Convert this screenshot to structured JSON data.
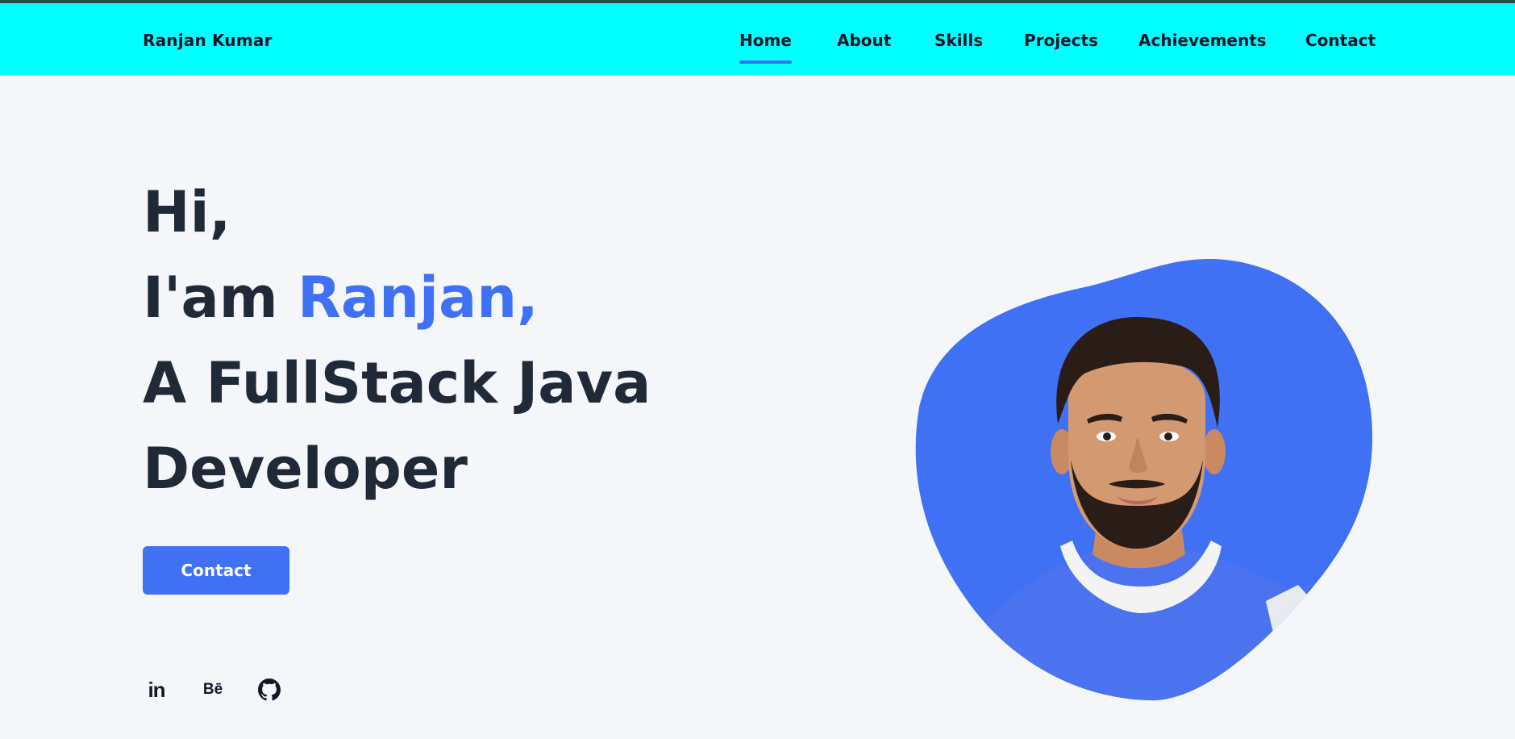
{
  "brand": "Ranjan Kumar",
  "nav": {
    "items": [
      {
        "label": "Home",
        "active": true
      },
      {
        "label": "About"
      },
      {
        "label": "Skills"
      },
      {
        "label": "Projects"
      },
      {
        "label": "Achievements"
      },
      {
        "label": "Contact"
      }
    ]
  },
  "hero": {
    "line1": "Hi,",
    "line2_prefix": "I'am ",
    "line2_name": "Ranjan,",
    "line3": "A FullStack Java",
    "line4": "Developer",
    "button_label": "Contact"
  },
  "socials": [
    {
      "icon": "linkedin-icon",
      "glyph": "in"
    },
    {
      "icon": "behance-icon",
      "glyph": "Bē"
    },
    {
      "icon": "github-icon"
    }
  ],
  "colors": {
    "navbar_bg": "#00ffff",
    "accent": "#4070f4",
    "page_bg": "#f4f6fa",
    "text_dark": "#1f2937"
  }
}
